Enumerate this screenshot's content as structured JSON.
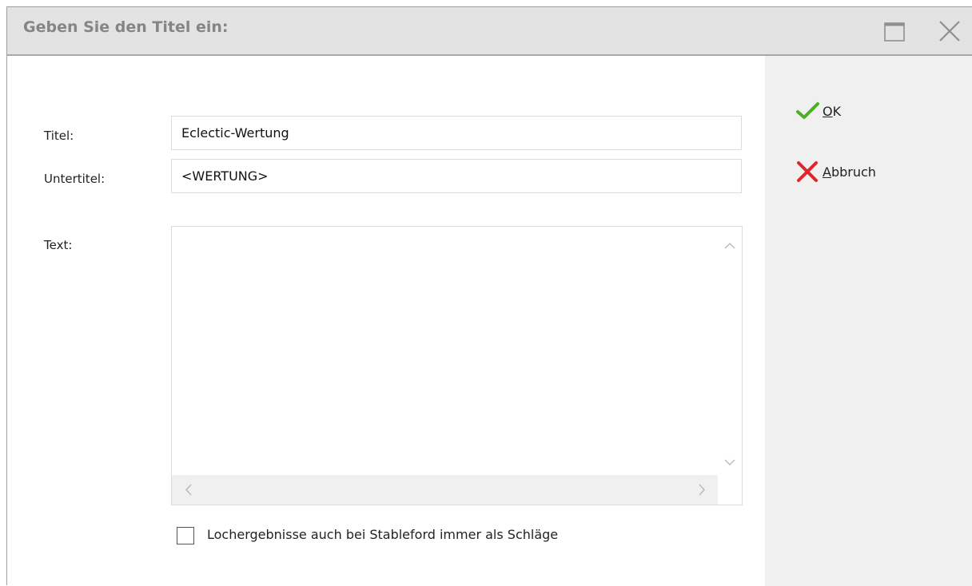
{
  "window": {
    "title": "Geben Sie den Titel ein:"
  },
  "form": {
    "titel_label": "Titel:",
    "titel_value": "Eclectic-Wertung",
    "untertitel_label": "Untertitel:",
    "untertitel_value": "<WERTUNG>",
    "text_label": "Text:",
    "text_value": "",
    "checkbox_label": "Lochergebnisse auch bei Stableford immer als Schläge",
    "checkbox_checked": false
  },
  "actions": {
    "ok_mnemonic": "O",
    "ok_rest": "K",
    "cancel_mnemonic": "A",
    "cancel_rest": "bbruch"
  },
  "colors": {
    "ok_check": "#4caf2a",
    "cancel_x": "#e0262b",
    "titlebar": "#e3e3e3",
    "side_panel": "#f0f0f0"
  },
  "icons": {
    "ok": "checkmark-icon",
    "cancel": "x-icon",
    "maximize": "maximize-icon",
    "close": "close-icon"
  }
}
